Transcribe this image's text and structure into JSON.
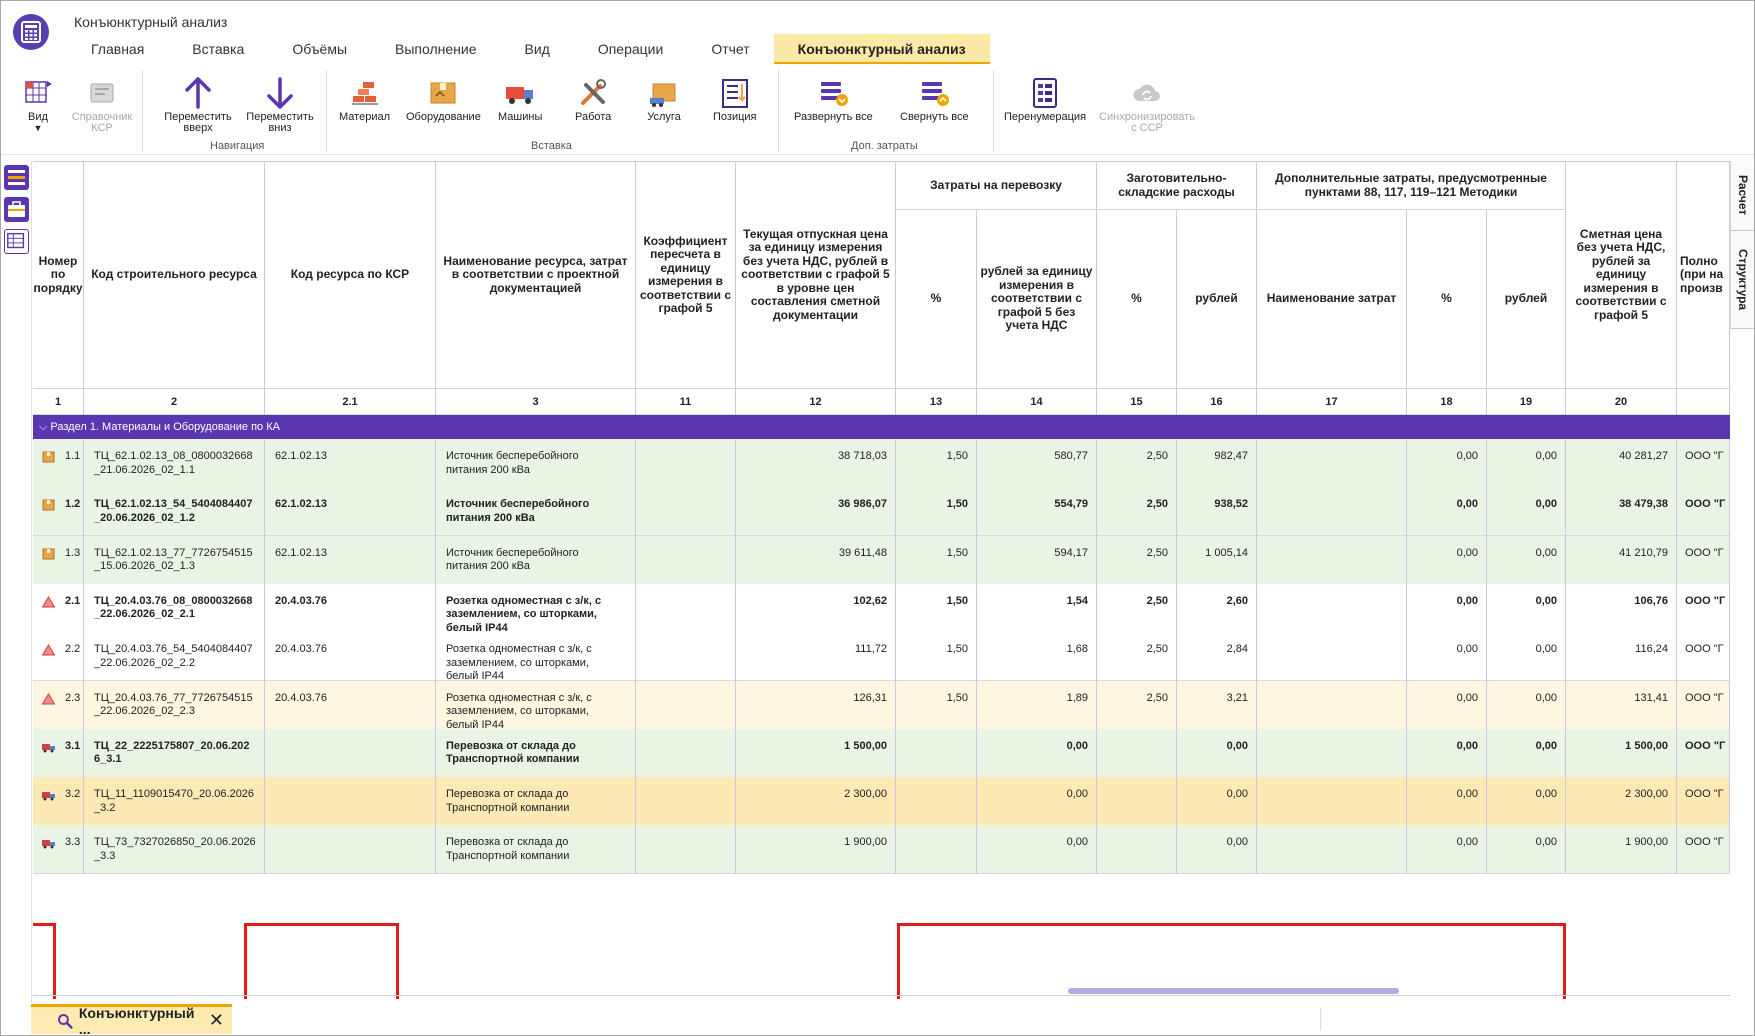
{
  "app": {
    "title": "Конъюнктурный анализ"
  },
  "tabs": [
    {
      "label": "Главная"
    },
    {
      "label": "Вставка"
    },
    {
      "label": "Объёмы"
    },
    {
      "label": "Выполнение"
    },
    {
      "label": "Вид"
    },
    {
      "label": "Операции"
    },
    {
      "label": "Отчет"
    },
    {
      "label": "Конъюнктурный анализ",
      "active": true
    }
  ],
  "ribbon": {
    "vid": "Вид",
    "spravochnik": "Справочник\nКСР",
    "move_up": "Переместить\nвверх",
    "move_down": "Переместить\nвниз",
    "nav_group": "Навигация",
    "material": "Материал",
    "oborudovanie": "Оборудование",
    "mashiny": "Машины",
    "rabota": "Работа",
    "usluga": "Услуга",
    "poziciya": "Позиция",
    "insert_group": "Вставка",
    "expand_all": "Развернуть все",
    "collapse_all": "Свернуть все",
    "extra_group": "Доп. затраты",
    "renumber": "Перенумерация",
    "sync": "Синхронизировать\nс ССР"
  },
  "side_tabs": {
    "raschet": "Расчет",
    "struktura": "Структура"
  },
  "header": {
    "c1": "Номер по порядку",
    "c2": "Код строительного ресурса",
    "c21": "Код ресурса по КСР",
    "c3": "Наименование ресурса, затрат в соответствии с проектной документацией",
    "c11": "Коэффициент пересчета в единицу измерения в соответствии с графой 5",
    "c12": "Текущая отпускная цена за единицу измерения без учета НДС, рублей в соответствии с графой 5 в уровне цен составления сметной документации",
    "g_transport": "Затраты на перевозку",
    "c13": "%",
    "c14": "рублей за единицу измерения в соответствии с графой 5 без учета НДС",
    "g_zagot": "Заготовительно-складские расходы",
    "c15": "%",
    "c16": "рублей",
    "g_dop": "Дополнительные затраты, предусмотренные пунктами 88, 117, 119–121 Методики",
    "c17": "Наименование затрат",
    "c18": "%",
    "c19": "рублей",
    "c20": "Сметная цена без учета НДС, рублей за единицу измерения в соответствии с графой 5",
    "c_last": "Полно (при на произв"
  },
  "col_numbers": [
    "1",
    "2",
    "2.1",
    "3",
    "11",
    "12",
    "13",
    "14",
    "15",
    "16",
    "17",
    "18",
    "19",
    "20"
  ],
  "section": {
    "title": "Раздел 1. Материалы и Оборудование по КА"
  },
  "rows": [
    {
      "num": "1.1",
      "code": "ТЦ_62.1.02.13_08_0800032668\n_21.06.2026_02_1.1",
      "ksr": "62.1.02.13",
      "name": "Источник бесперебойного\nпитания 200 кВа",
      "c11": "",
      "c12": "38 718,03",
      "c13": "1,50",
      "c14": "580,77",
      "c15": "2,50",
      "c16": "982,47",
      "c17": "",
      "c18": "0,00",
      "c19": "0,00",
      "c20": "40 281,27",
      "last": "ООО \"Г",
      "bold": false,
      "icon": "box",
      "bg": "#eaf4e4"
    },
    {
      "num": "1.2",
      "code": "ТЦ_62.1.02.13_54_5404084407\n_20.06.2026_02_1.2",
      "ksr": "62.1.02.13",
      "name": "Источник бесперебойного\nпитания 200 кВа",
      "c11": "",
      "c12": "36 986,07",
      "c13": "1,50",
      "c14": "554,79",
      "c15": "2,50",
      "c16": "938,52",
      "c17": "",
      "c18": "0,00",
      "c19": "0,00",
      "c20": "38 479,38",
      "last": "ООО \"Г",
      "bold": true,
      "icon": "box",
      "bg": "#eaf4e4"
    },
    {
      "num": "1.3",
      "code": "ТЦ_62.1.02.13_77_7726754515\n_15.06.2026_02_1.3",
      "ksr": "62.1.02.13",
      "name": "Источник бесперебойного\nпитания 200 кВа",
      "c11": "",
      "c12": "39 611,48",
      "c13": "1,50",
      "c14": "594,17",
      "c15": "2,50",
      "c16": "1 005,14",
      "c17": "",
      "c18": "0,00",
      "c19": "0,00",
      "c20": "41 210,79",
      "last": "ООО \"Г",
      "bold": false,
      "icon": "box",
      "bg": "#eaf4e4"
    },
    {
      "num": "2.1",
      "code": "ТЦ_20.4.03.76_08_0800032668\n_22.06.2026_02_2.1",
      "ksr": "20.4.03.76",
      "name": "Розетка одноместная с з/к, с\nзаземлением, со шторками,\nбелый IP44",
      "c11": "",
      "c12": "102,62",
      "c13": "1,50",
      "c14": "1,54",
      "c15": "2,50",
      "c16": "2,60",
      "c17": "",
      "c18": "0,00",
      "c19": "0,00",
      "c20": "106,76",
      "last": "ООО \"Г",
      "bold": true,
      "icon": "tri",
      "bg": "#ffffff"
    },
    {
      "num": "2.2",
      "code": "ТЦ_20.4.03.76_54_5404084407\n_22.06.2026_02_2.2",
      "ksr": "20.4.03.76",
      "name": "Розетка одноместная с з/к, с\nзаземлением, со шторками,\nбелый IP44",
      "c11": "",
      "c12": "111,72",
      "c13": "1,50",
      "c14": "1,68",
      "c15": "2,50",
      "c16": "2,84",
      "c17": "",
      "c18": "0,00",
      "c19": "0,00",
      "c20": "116,24",
      "last": "ООО \"Г",
      "bold": false,
      "icon": "tri",
      "bg": "#ffffff"
    },
    {
      "num": "2.3",
      "code": "ТЦ_20.4.03.76_77_7726754515\n_22.06.2026_02_2.3",
      "ksr": "20.4.03.76",
      "name": "Розетка одноместная с з/к, с\nзаземлением, со шторками,\nбелый IP44",
      "c11": "",
      "c12": "126,31",
      "c13": "1,50",
      "c14": "1,89",
      "c15": "2,50",
      "c16": "3,21",
      "c17": "",
      "c18": "0,00",
      "c19": "0,00",
      "c20": "131,41",
      "last": "ООО \"Г",
      "bold": false,
      "icon": "tri",
      "bg": "#fdf6e0"
    },
    {
      "num": "3.1",
      "code": "ТЦ_22_2225175807_20.06.202\n6_3.1",
      "ksr": "",
      "name": "Перевозка от склада до\nТранспортной компании",
      "c11": "",
      "c12": "1 500,00",
      "c13": "",
      "c14": "0,00",
      "c15": "",
      "c16": "0,00",
      "c17": "",
      "c18": "0,00",
      "c19": "0,00",
      "c20": "1 500,00",
      "last": "ООО \"Г",
      "bold": true,
      "icon": "truck",
      "bg": "#eaf4e4"
    },
    {
      "num": "3.2",
      "code": "ТЦ_11_1109015470_20.06.2026\n_3.2",
      "ksr": "",
      "name": "Перевозка от склада до\nТранспортной компании",
      "c11": "",
      "c12": "2 300,00",
      "c13": "",
      "c14": "0,00",
      "c15": "",
      "c16": "0,00",
      "c17": "",
      "c18": "0,00",
      "c19": "0,00",
      "c20": "2 300,00",
      "last": "ООО \"Г",
      "bold": false,
      "icon": "truck",
      "bg": "#fce9b4"
    },
    {
      "num": "3.3",
      "code": "ТЦ_73_7327026850_20.06.2026\n_3.3",
      "ksr": "",
      "name": "Перевозка от склада до\nТранспортной компании",
      "c11": "",
      "c12": "1 900,00",
      "c13": "",
      "c14": "0,00",
      "c15": "",
      "c16": "0,00",
      "c17": "",
      "c18": "0,00",
      "c19": "0,00",
      "c20": "1 900,00",
      "last": "ООО \"Г",
      "bold": false,
      "icon": "truck",
      "bg": "#eaf4e4"
    }
  ],
  "bottom_tab": {
    "label": "Конъюнктурный ...",
    "close": "✕"
  },
  "colors": {
    "accent": "#5b36b1",
    "highlight": "#e31b1b",
    "tab_active": "#fce9a6"
  }
}
